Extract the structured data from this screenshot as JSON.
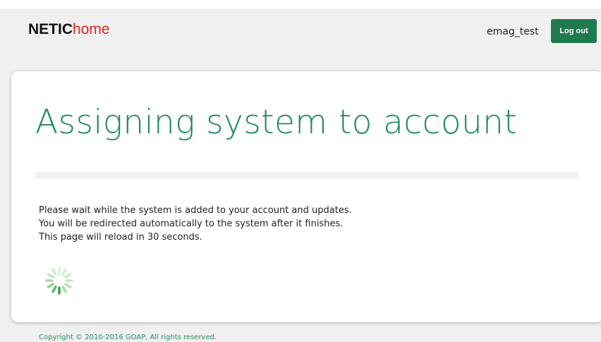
{
  "header": {
    "logo_part1": "NETIC",
    "logo_part2": "home",
    "username": "emag_test",
    "logout_label": "Log out"
  },
  "main": {
    "title": "Assigning system to account",
    "messages": [
      "Please wait while the system is added to your account and updates.",
      "You will be redirected automatically to the system after it finishes.",
      "This page will reload in 30 seconds."
    ],
    "spinner_icon": "loading-spinner-icon"
  },
  "footer": {
    "copyright": "Copyright © 2010-2016 GOAP, All rights reserved."
  },
  "colors": {
    "brand_green": "#1e8a5a",
    "button_green": "#1f7a4f",
    "logo_red": "#e2261d",
    "page_background": "#f0f0f0"
  }
}
